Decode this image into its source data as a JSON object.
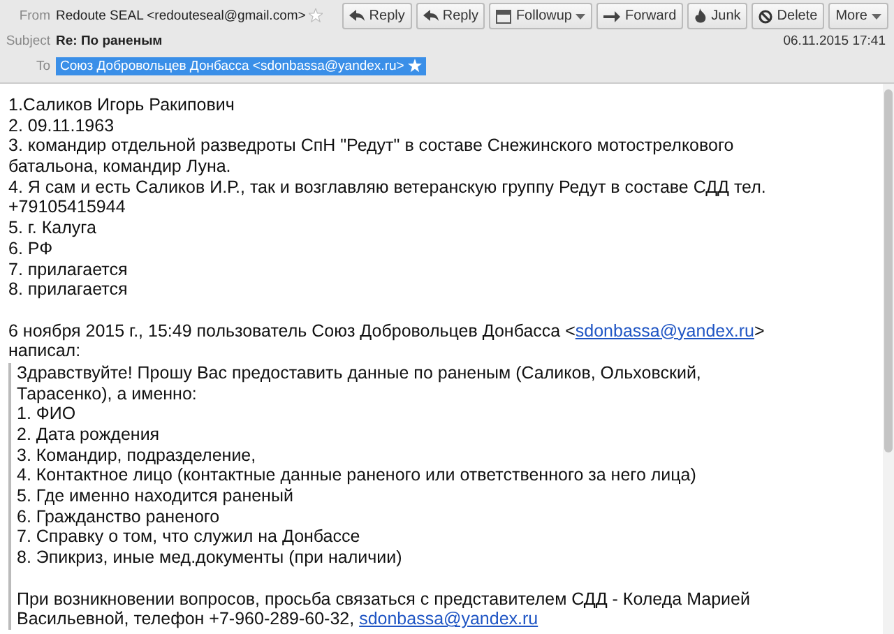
{
  "header": {
    "from_label": "From",
    "from": "Redoute SEAL <redouteseal@gmail.com>",
    "subject_label": "Subject",
    "subject": "Re: По раненым",
    "to_label": "To",
    "to": "Союз Добровольцев Донбасса <sdonbassa@yandex.ru>",
    "to_selected": true,
    "date": "06.11.2015 17:41"
  },
  "buttons": [
    {
      "label": "Reply",
      "kind": "reply",
      "dropdown": false
    },
    {
      "label": "Reply",
      "kind": "reply",
      "dropdown": false
    },
    {
      "label": "Followup",
      "kind": "followup",
      "dropdown": true
    },
    {
      "label": "Forward",
      "kind": "forward",
      "dropdown": false
    },
    {
      "label": "Junk",
      "kind": "junk",
      "dropdown": false
    },
    {
      "label": "Delete",
      "kind": "delete",
      "dropdown": false
    },
    {
      "label": "More",
      "kind": "more",
      "dropdown": true
    }
  ],
  "body": [
    "1.Саликов Игорь Ракипович",
    "2. 09.11.1963",
    "3. командир отдельной разведроты СпН  \"Редут\" в составе Снежинского мотострелкового",
    "батальона, командир Луна.",
    "4. Я сам и есть Саликов И.Р., так и возглавляю ветеранскую группу Редут в составе СДД тел.",
    "+79105415944",
    "5. г. Калуга",
    "6. РФ",
    "7. прилагается",
    "8. прилагается"
  ],
  "attribution": {
    "before": "6 ноября 2015 г., 15:49 пользователь Союз Добровольцев Донбасса <",
    "link": "sdonbassa@yandex.ru",
    "after": ">",
    "second_line": "написал:"
  },
  "quote": [
    "Здравствуйте! Прошу Вас предоставить данные по раненым (Саликов, Ольховский,",
    "Тарасенко), а именно:",
    "1. ФИО",
    "2. Дата рождения",
    "3. Командир, подразделение,",
    "4. Контактное лицо (контактные данные раненого или ответственного за него лица)",
    "5. Где именно находится раненый",
    "6. Гражданство раненого",
    "7. Справку о том, что служил на Донбассе",
    "8. Эпикриз, иные мед.документы (при наличии)"
  ],
  "quote_footer": {
    "line1": "При возникновении вопросов, просьба связаться с представителем СДД - Коледа Марией",
    "line2_before": "Васильевной, телефон +7-960-289-60-32, ",
    "link": "sdonbassa@yandex.ru"
  }
}
